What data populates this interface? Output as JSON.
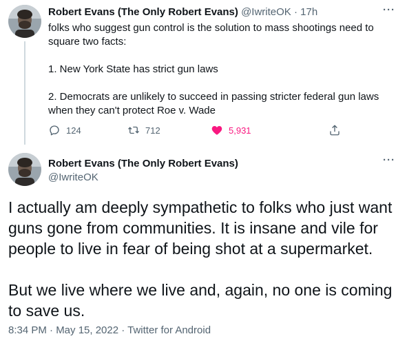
{
  "tweet_parent": {
    "display_name": "Robert Evans (The Only Robert Evans)",
    "handle": "@IwriteOK",
    "separator": " · ",
    "time_ago": "17h",
    "more_label": "···",
    "lines": [
      "folks who suggest gun control is the solution to mass shootings need to",
      "square two facts:",
      "",
      "1. New York State has strict gun laws",
      "",
      "2. Democrats are unlikely to succeed in passing stricter federal gun laws",
      "when they can't protect Roe v. Wade"
    ],
    "reply_count": "124",
    "retweet_count": "712",
    "like_count": "5,931",
    "liked": true,
    "icons": [
      "reply-icon",
      "retweet-icon",
      "like-icon",
      "share-icon"
    ]
  },
  "tweet_main": {
    "display_name": "Robert Evans (The Only Robert Evans)",
    "handle": "@IwriteOK",
    "more_label": "···",
    "lines": [
      "I actually am deeply sympathetic to folks who just want",
      "guns gone from communities. It is insane and vile for",
      "people to live in fear of being shot at a supermarket.",
      "",
      "But we live where we live and, again, no one is coming",
      "to save us."
    ],
    "timestamp": "8:34 PM · May 15, 2022 · Twitter for Android"
  },
  "colors": {
    "text": "#0f1419",
    "muted": "#536471",
    "like": "#f91880",
    "thread_line": "#cfd9de"
  }
}
